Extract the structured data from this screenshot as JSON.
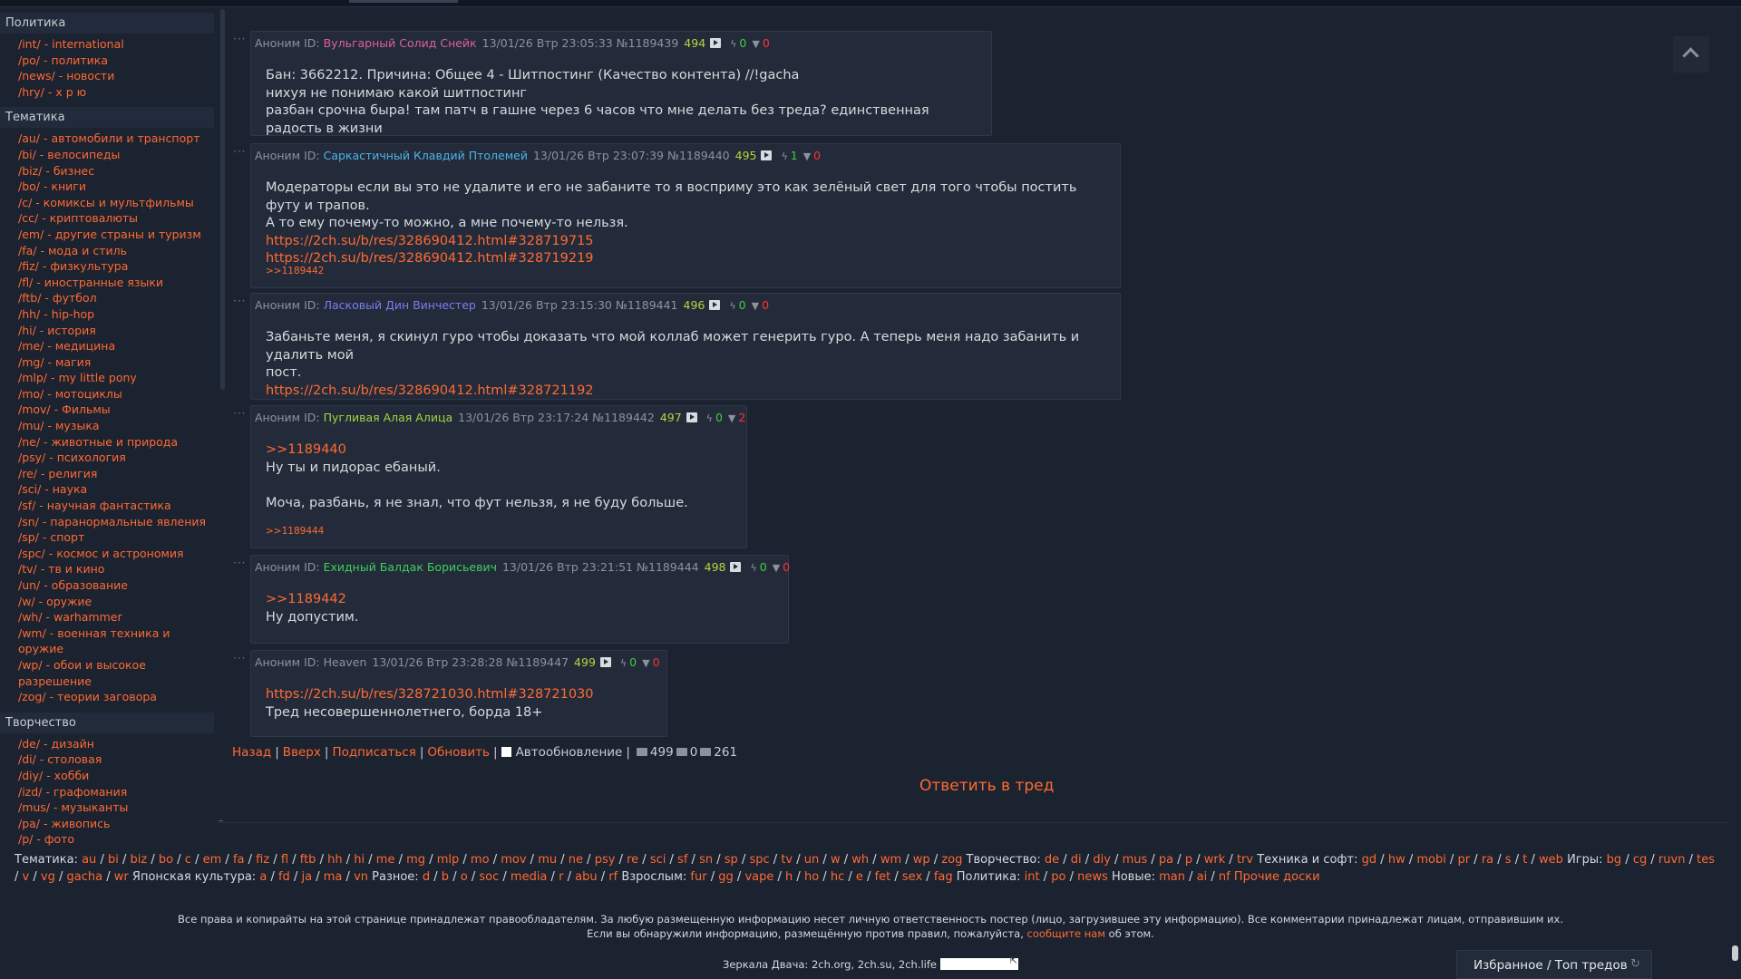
{
  "sidebar": {
    "sections": [
      {
        "title": "Политика",
        "items": [
          {
            "label": "/int/ - international"
          },
          {
            "label": "/po/ - политика"
          },
          {
            "label": "/news/ - новости"
          },
          {
            "label": "/hry/ - х р ю"
          }
        ]
      },
      {
        "title": "Тематика",
        "items": [
          {
            "label": "/au/ - автомобили и транспорт"
          },
          {
            "label": "/bi/ - велосипеды"
          },
          {
            "label": "/biz/ - бизнес"
          },
          {
            "label": "/bo/ - книги"
          },
          {
            "label": "/c/ - комиксы и мультфильмы"
          },
          {
            "label": "/cc/ - криптовалюты"
          },
          {
            "label": "/em/ - другие страны и туризм"
          },
          {
            "label": "/fa/ - мода и стиль"
          },
          {
            "label": "/fiz/ - физкультура"
          },
          {
            "label": "/fl/ - иностранные языки"
          },
          {
            "label": "/ftb/ - футбол"
          },
          {
            "label": "/hh/ - hip-hop"
          },
          {
            "label": "/hi/ - история"
          },
          {
            "label": "/me/ - медицина"
          },
          {
            "label": "/mg/ - магия"
          },
          {
            "label": "/mlp/ - my little pony"
          },
          {
            "label": "/mo/ - мотоциклы"
          },
          {
            "label": "/mov/ - Фильмы"
          },
          {
            "label": "/mu/ - музыка"
          },
          {
            "label": "/ne/ - животные и природа"
          },
          {
            "label": "/psy/ - психология"
          },
          {
            "label": "/re/ - религия"
          },
          {
            "label": "/sci/ - наука"
          },
          {
            "label": "/sf/ - научная фантастика"
          },
          {
            "label": "/sn/ - паранормальные явления"
          },
          {
            "label": "/sp/ - спорт"
          },
          {
            "label": "/spc/ - космос и астрономия"
          },
          {
            "label": "/tv/ - тв и кино"
          },
          {
            "label": "/un/ - образование"
          },
          {
            "label": "/w/ - оружие"
          },
          {
            "label": "/wh/ - warhammer"
          },
          {
            "label": "/wm/ - военная техника и оружие"
          },
          {
            "label": "/wp/ - обои и высокое"
          },
          {
            "label": "разрешение"
          },
          {
            "label": "/zog/ - теории заговора"
          }
        ]
      },
      {
        "title": "Творчество",
        "items": [
          {
            "label": "/de/ - дизайн"
          },
          {
            "label": "/di/ - столовая"
          },
          {
            "label": "/diy/ - хобби"
          },
          {
            "label": "/izd/ - графомания"
          },
          {
            "label": "/mus/ - музыканты"
          },
          {
            "label": "/pa/ - живопись"
          },
          {
            "label": "/p/ - фото"
          }
        ]
      }
    ]
  },
  "posts": [
    {
      "anon": "Аноним ID:",
      "name": "Вульгарный Солид Снейк",
      "name_color": "#e0609a",
      "meta": "13/01/26 Втр 23:05:33 №1189439",
      "count": "494",
      "likes": "0",
      "dislikes": "0",
      "lines": [
        "Бан: 3662212. Причина: Общее 4 - Шитпостинг (Качество контента) //!gacha",
        "нихуя не понимаю какой шитпостинг",
        "разбан срочна быра! там патч в гашне через 6 часов что мне делать без треда? единственная радость в жизни"
      ]
    },
    {
      "anon": "Аноним ID:",
      "name": "Саркастичный Клавдий Птолемей",
      "name_color": "#4fb3e8",
      "meta": "13/01/26 Втр 23:07:39 №1189440",
      "count": "495",
      "likes": "1",
      "dislikes": "0",
      "lines": [
        "Модераторы если вы это не удалите и его не забаните то я восприму это как зелёный свет для того чтобы постить футу и трапов.",
        "А то ему почему-то можно, а мне почему-то нельзя."
      ],
      "links": [
        "https://2ch.su/b/res/328690412.html#328719715",
        "https://2ch.su/b/res/328690412.html#328719219"
      ],
      "reply": ">>1189442"
    },
    {
      "anon": "Аноним ID:",
      "name": "Ласковый Дин Винчестер",
      "name_color": "#7b7cf0",
      "meta": "13/01/26 Втр 23:15:30 №1189441",
      "count": "496",
      "likes": "0",
      "dislikes": "0",
      "lines": [
        "Забаньте меня, я скинул гуро чтобы доказать что мой коллаб может генерить гуро. А теперь меня надо забанить и удалить мой",
        "пост."
      ],
      "links": [
        "https://2ch.su/b/res/328690412.html#328721192"
      ]
    },
    {
      "anon": "Аноним ID:",
      "name": "Пугливая Алая Алица",
      "name_color": "#9fd83a",
      "meta": "13/01/26 Втр 23:17:24 №1189442",
      "count": "497",
      "likes": "0",
      "dislikes": "2",
      "quote": ">>1189440",
      "lines": [
        "Ну ты и пидорас ебаный.",
        "",
        "Моча, разбань, я не знал, что фут нельзя, я не буду больше."
      ],
      "reply": ">>1189444"
    },
    {
      "anon": "Аноним ID:",
      "name": "Ехидный Балдак Борисьевич",
      "name_color": "#3ecf5a",
      "meta": "13/01/26 Втр 23:21:51 №1189444",
      "count": "498",
      "likes": "0",
      "dislikes": "0",
      "quote": ">>1189442",
      "lines": [
        "Ну допустим."
      ]
    },
    {
      "anon": "Аноним ID:",
      "name": "Heaven",
      "name_color": "#8c929c",
      "meta": "13/01/26 Втр 23:28:28 №1189447",
      "count": "499",
      "likes": "0",
      "dislikes": "0",
      "links": [
        "https://2ch.su/b/res/328721030.html#328721030"
      ],
      "lines": [
        "Тред несовершеннолетнего, борда 18+"
      ]
    }
  ],
  "thread_nav": {
    "back": "Назад",
    "up": "Вверх",
    "subscribe": "Подписаться",
    "refresh": "Обновить",
    "autoupdate": "Автообновление",
    "posts_count": "499",
    "files_count": "0",
    "posters_count": "261"
  },
  "reply_button": "Ответить в тред",
  "bottom_nav": {
    "groups": [
      {
        "label": "Тематика:",
        "boards": [
          "au",
          "bi",
          "biz",
          "bo",
          "c",
          "em",
          "fa",
          "fiz",
          "fl",
          "ftb",
          "hh",
          "hi",
          "me",
          "mg",
          "mlp",
          "mo",
          "mov",
          "mu",
          "ne",
          "psy",
          "re",
          "sci",
          "sf",
          "sn",
          "sp",
          "spc",
          "tv",
          "un",
          "w",
          "wh",
          "wm",
          "wp",
          "zog"
        ]
      },
      {
        "label": "Творчество:",
        "boards": [
          "de",
          "di",
          "diy",
          "mus",
          "pa",
          "p",
          "wrk",
          "trv"
        ]
      },
      {
        "label": "Техника и софт:",
        "boards": [
          "gd",
          "hw",
          "mobi",
          "pr",
          "ra",
          "s",
          "t",
          "web"
        ]
      },
      {
        "label": "Игры:",
        "boards": [
          "bg",
          "cg",
          "ruvn",
          "tes",
          "v",
          "vg",
          "gacha",
          "wr"
        ]
      },
      {
        "label": "Японская культура:",
        "boards": [
          "a",
          "fd",
          "ja",
          "ma",
          "vn"
        ]
      },
      {
        "label": "Разное:",
        "boards": [
          "d",
          "b",
          "o",
          "soc",
          "media",
          "r",
          "abu",
          "rf"
        ]
      },
      {
        "label": "Взрослым:",
        "boards": [
          "fur",
          "gg",
          "vape",
          "h",
          "ho",
          "hc",
          "e",
          "fet",
          "sex",
          "fag"
        ]
      },
      {
        "label": "Политика:",
        "boards": [
          "int",
          "po",
          "news"
        ]
      },
      {
        "label": "Новые:",
        "boards": [
          "man",
          "ai",
          "nf"
        ]
      }
    ],
    "other": "Прочие доски"
  },
  "footer": {
    "line1": "Все права и копирайты на этой странице принадлежат правообладателям. За любую размещенную информацию несет личную ответственность постер (лицо, загрузившее эту информацию). Все комментарии принадлежат лицам, отправившим их.",
    "line2_pre": "Если вы обнаружили информацию, размещённую против правил, пожалуйста,",
    "line2_link": "сообщите нам",
    "line2_post": "об этом.",
    "mirrors": "Зеркала Двача: 2ch.org, 2ch.su, 2ch.life"
  },
  "fav_panel": {
    "label": "Избранное / Топ тредов"
  },
  "colors": {
    "accent": "#ff6a32",
    "bg": "#1b2230",
    "post_bg": "#232b3a",
    "likes": "#3ecf3e",
    "dislikes": "#ff3030",
    "count": "#b9d33b"
  }
}
